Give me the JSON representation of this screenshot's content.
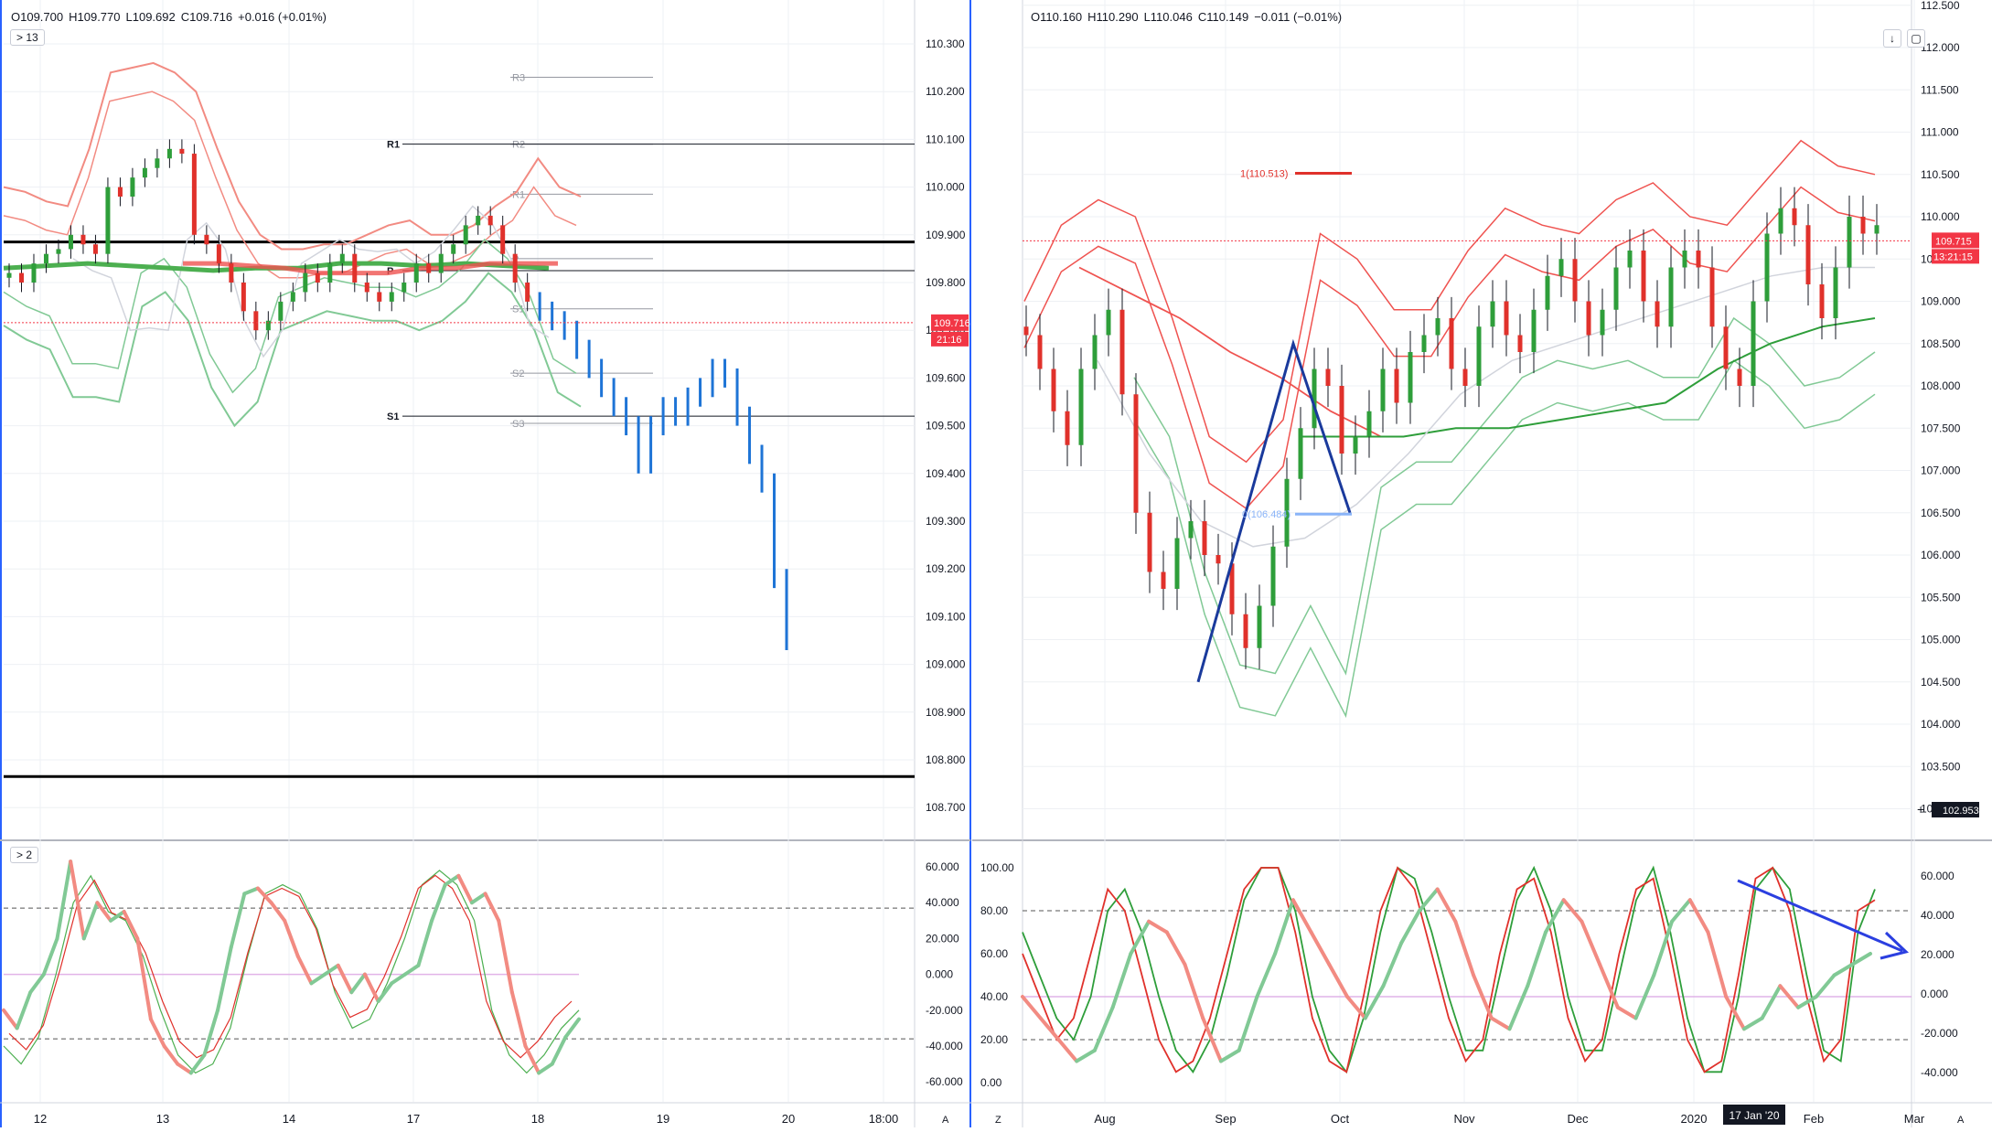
{
  "left_panel": {
    "ohlc": {
      "open": "O109.700",
      "high": "H109.770",
      "low": "L109.692",
      "close": "C109.716",
      "change": "+0.016 (+0.01%)"
    },
    "collapse_badge_main": "> 13",
    "collapse_badge_osc": "> 2",
    "price_label": "109.716",
    "countdown_label": "21:16",
    "corner_label": "A",
    "pivots": {
      "black": [
        {
          "label": "R1",
          "value": 110.09
        },
        {
          "label": "P",
          "value": 109.825
        },
        {
          "label": "S1",
          "value": 109.52
        }
      ],
      "gray": [
        {
          "label": "R3",
          "value": 110.23
        },
        {
          "label": "R2",
          "value": 110.09
        },
        {
          "label": "R1",
          "value": 109.985
        },
        {
          "label": "P",
          "value": 109.85
        },
        {
          "label": "S1",
          "value": 109.745
        },
        {
          "label": "S2",
          "value": 109.61
        },
        {
          "label": "S3",
          "value": 109.505
        }
      ]
    }
  },
  "right_panel": {
    "ohlc": {
      "open": "O110.160",
      "high": "H110.290",
      "low": "L110.046",
      "close": "C110.149",
      "change": "−0.011 (−0.01%)"
    },
    "price_label": "109.715",
    "countdown_label": "13:21:15",
    "crosshair_label": "102.953",
    "fib_label_top": "1(110.513)",
    "fib_label_bottom": "0(106.484)",
    "date_highlight": "17 Jan '20",
    "corner_left": "Z",
    "corner_right": "A",
    "tool_down": "↓",
    "tool_frame": "▢"
  },
  "chart_data": [
    {
      "type": "bar",
      "name": "USDJPY intraday (left main pane)",
      "x_ticks": [
        "12",
        "13",
        "14",
        "17",
        "18",
        "19",
        "20",
        "18:00"
      ],
      "y_ticks": [
        "110.300",
        "110.200",
        "110.100",
        "110.000",
        "109.900",
        "109.800",
        "109.700",
        "109.600",
        "109.500",
        "109.400",
        "109.300",
        "109.200",
        "109.100",
        "109.000",
        "108.900",
        "108.800",
        "108.700"
      ],
      "ylim": [
        108.66,
        110.38
      ],
      "horizontal_lines": [
        109.885,
        108.765
      ],
      "close_series": [
        109.82,
        109.8,
        109.84,
        109.86,
        109.87,
        109.9,
        109.88,
        109.86,
        110.0,
        109.98,
        110.02,
        110.04,
        110.06,
        110.08,
        110.07,
        109.9,
        109.88,
        109.84,
        109.8,
        109.74,
        109.7,
        109.72,
        109.76,
        109.78,
        109.82,
        109.8,
        109.84,
        109.86,
        109.8,
        109.78,
        109.76,
        109.78,
        109.8,
        109.84,
        109.82,
        109.86,
        109.88,
        109.92,
        109.94,
        109.92,
        109.86,
        109.8,
        109.76,
        109.74,
        109.72,
        109.7,
        109.66,
        109.62,
        109.58,
        109.54,
        109.5,
        109.42,
        109.5,
        109.54,
        109.52,
        109.56,
        109.58,
        109.62,
        109.6,
        109.52,
        109.44,
        109.38,
        109.18,
        109.05
      ],
      "series": [
        {
          "name": "bollinger-upper-red",
          "values": [
            110.0,
            109.99,
            109.97,
            109.96,
            110.08,
            110.24,
            110.25,
            110.26,
            110.24,
            110.2,
            110.08,
            109.97,
            109.9,
            109.87,
            109.87,
            109.88,
            109.88,
            109.9,
            109.92,
            109.93,
            109.9,
            109.9,
            109.92,
            109.96,
            109.99,
            110.06,
            110.0,
            109.98
          ]
        },
        {
          "name": "bollinger-lower-green",
          "values": [
            109.71,
            109.68,
            109.66,
            109.56,
            109.56,
            109.55,
            109.75,
            109.78,
            109.72,
            109.58,
            109.5,
            109.55,
            109.7,
            109.72,
            109.74,
            109.73,
            109.72,
            109.72,
            109.7,
            109.72,
            109.76,
            109.82,
            109.78,
            109.7,
            109.57,
            109.54
          ]
        },
        {
          "name": "moving-average-green-thick",
          "values": [
            109.83,
            109.835,
            109.84,
            109.835,
            109.83,
            109.825,
            109.83,
            109.83,
            109.84,
            109.84,
            109.835,
            109.84,
            109.835,
            109.83
          ]
        },
        {
          "name": "moving-average-red-thick",
          "values": [
            109.84,
            109.84,
            109.835,
            109.83,
            109.82,
            109.82,
            109.82,
            109.83,
            109.83,
            109.84,
            109.84,
            109.84
          ]
        }
      ]
    },
    {
      "type": "line",
      "name": "left oscillator",
      "y_ticks": [
        "60.000",
        "40.000",
        "20.000",
        "0.000",
        "-20.000",
        "-40.000",
        "-60.000"
      ],
      "ylim": [
        -68,
        68
      ],
      "dashed_levels": [
        37,
        -36
      ],
      "zero_line": 0,
      "series": [
        {
          "name": "fast",
          "values": [
            -20,
            -30,
            -10,
            0,
            20,
            63,
            20,
            40,
            30,
            35,
            20,
            -25,
            -40,
            -50,
            -55,
            -45,
            -20,
            15,
            45,
            48,
            40,
            30,
            10,
            -5,
            0,
            5,
            -10,
            0,
            -15,
            -5,
            0,
            5,
            30,
            50,
            55,
            40,
            45,
            30,
            -10,
            -40,
            -55,
            -50,
            -35,
            -25
          ]
        },
        {
          "name": "slow-green",
          "values": [
            -40,
            -50,
            -35,
            0,
            40,
            55,
            35,
            30,
            10,
            -20,
            -45,
            -55,
            -50,
            -30,
            10,
            45,
            50,
            45,
            25,
            -10,
            -30,
            -25,
            -5,
            20,
            50,
            58,
            50,
            30,
            -20,
            -45,
            -55,
            -45,
            -30,
            -20
          ]
        }
      ]
    },
    {
      "type": "bar",
      "name": "USDJPY daily (right main pane)",
      "x_ticks": [
        "Aug",
        "Sep",
        "Oct",
        "Nov",
        "Dec",
        "2020",
        "Feb",
        "Mar"
      ],
      "y_ticks": [
        "112.500",
        "112.000",
        "111.500",
        "111.000",
        "110.500",
        "110.000",
        "109.500",
        "109.000",
        "108.500",
        "108.000",
        "107.500",
        "107.000",
        "106.500",
        "106.000",
        "105.500",
        "105.000",
        "104.500",
        "104.000",
        "103.500",
        "103.000"
      ],
      "ylim": [
        102.62,
        112.53
      ],
      "close_series": [
        108.6,
        108.2,
        107.7,
        107.3,
        108.2,
        108.6,
        108.9,
        107.9,
        106.5,
        105.8,
        105.6,
        106.2,
        106.4,
        106.0,
        105.9,
        105.3,
        104.9,
        105.4,
        106.1,
        106.9,
        107.5,
        108.2,
        108.0,
        107.2,
        107.4,
        107.7,
        108.2,
        107.8,
        108.4,
        108.6,
        108.8,
        108.2,
        108.0,
        108.7,
        109.0,
        108.6,
        108.4,
        108.9,
        109.3,
        109.5,
        109.0,
        108.6,
        108.9,
        109.4,
        109.6,
        109.0,
        108.7,
        109.4,
        109.6,
        109.4,
        108.7,
        108.2,
        108.0,
        109.0,
        109.8,
        110.1,
        109.9,
        109.2,
        108.8,
        109.4,
        110.0,
        109.8,
        109.9
      ],
      "trend_polyline": [
        [
          "Aug 25",
          104.5
        ],
        [
          "Sep 20",
          108.5
        ],
        [
          "Oct 4",
          106.5
        ]
      ],
      "series": [
        {
          "name": "bollinger-upper-red",
          "values": [
            109.0,
            109.9,
            110.2,
            110.0,
            108.8,
            107.4,
            107.1,
            107.6,
            109.8,
            109.5,
            108.9,
            108.9,
            109.6,
            110.1,
            109.9,
            109.8,
            110.2,
            110.4,
            110.0,
            109.9,
            110.4,
            110.9,
            110.6,
            110.5
          ]
        },
        {
          "name": "bollinger-lower-green",
          "values": [
            107.6,
            106.9,
            105.3,
            104.2,
            104.1,
            104.9,
            104.1,
            106.3,
            106.6,
            106.6,
            107.1,
            107.6,
            107.8,
            107.7,
            107.8,
            107.6,
            107.6,
            108.3,
            108.0,
            107.5,
            107.6,
            107.9
          ]
        },
        {
          "name": "moving-average-red",
          "values": [
            109.4,
            109.1,
            108.8,
            108.4,
            108.1,
            107.7,
            107.4
          ]
        },
        {
          "name": "moving-average-green",
          "values": [
            107.4,
            107.4,
            107.4,
            107.5,
            107.5,
            107.6,
            107.7,
            107.8,
            108.2,
            108.5,
            108.7,
            108.8
          ]
        }
      ]
    },
    {
      "type": "line",
      "name": "right oscillator",
      "y_ticks_left": [
        "100.00",
        "80.00",
        "60.00",
        "40.00",
        "20.00",
        "0.00"
      ],
      "y_ticks_right": [
        "60.000",
        "40.000",
        "20.000",
        "0.000",
        "-20.000",
        "-40.000"
      ],
      "ylim": [
        -5,
        105
      ],
      "dashed_levels": [
        80,
        20
      ],
      "baseline": 40,
      "series": [
        {
          "name": "fast-red",
          "values": [
            60,
            40,
            20,
            30,
            60,
            90,
            80,
            50,
            20,
            5,
            10,
            30,
            60,
            90,
            100,
            100,
            70,
            30,
            10,
            5,
            40,
            80,
            100,
            90,
            60,
            30,
            10,
            20,
            60,
            90,
            95,
            70,
            30,
            10,
            20,
            60,
            90,
            95,
            60,
            20,
            5,
            10,
            50,
            95,
            100,
            80,
            40,
            10,
            20,
            80,
            85
          ]
        },
        {
          "name": "slow-green",
          "values": [
            70,
            50,
            30,
            20,
            40,
            80,
            90,
            70,
            40,
            15,
            5,
            20,
            50,
            85,
            100,
            100,
            80,
            40,
            15,
            5,
            30,
            70,
            100,
            95,
            70,
            40,
            15,
            15,
            50,
            85,
            100,
            80,
            40,
            15,
            15,
            50,
            85,
            100,
            70,
            30,
            5,
            5,
            40,
            90,
            100,
            90,
            50,
            15,
            10,
            70,
            90
          ]
        }
      ]
    }
  ]
}
